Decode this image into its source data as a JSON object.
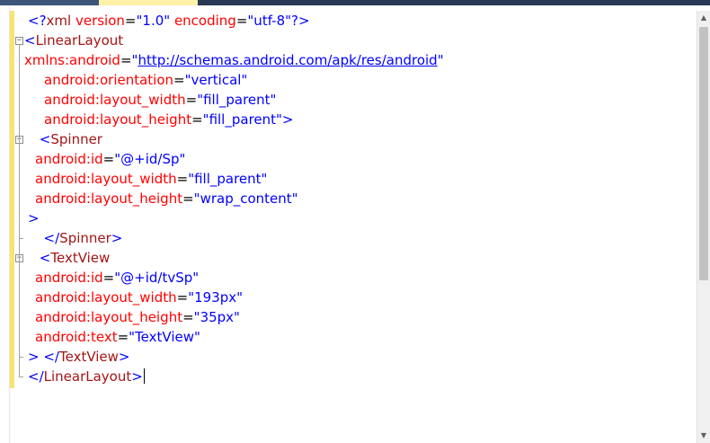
{
  "editor": {
    "lines": [
      {
        "indent": 1,
        "tokens": [
          [
            "br",
            "<?"
          ],
          [
            "tag",
            "xml"
          ],
          [
            "eq",
            " "
          ],
          [
            "attr",
            "version"
          ],
          [
            "eq",
            "="
          ],
          [
            "val",
            "\"1.0\""
          ],
          [
            "eq",
            " "
          ],
          [
            "attr",
            "encoding"
          ],
          [
            "eq",
            "="
          ],
          [
            "val",
            "\"utf-8\""
          ],
          [
            "br",
            "?>"
          ]
        ]
      },
      {
        "indent": 0,
        "tokens": [
          [
            "br",
            "<"
          ],
          [
            "tag",
            "LinearLayout"
          ]
        ]
      },
      {
        "indent": 0,
        "tokens": [
          [
            "attr",
            "xmlns:android"
          ],
          [
            "eq",
            "="
          ],
          [
            "val",
            "\""
          ],
          [
            "link",
            "http://schemas.android.com/apk/res/android"
          ],
          [
            "val",
            "\""
          ]
        ]
      },
      {
        "indent": 2,
        "tokens": [
          [
            "attr",
            "android:orientation"
          ],
          [
            "eq",
            "="
          ],
          [
            "val",
            "\"vertical\""
          ]
        ]
      },
      {
        "indent": 2,
        "tokens": [
          [
            "attr",
            "android:layout_width"
          ],
          [
            "eq",
            "="
          ],
          [
            "val",
            "\"fill_parent\""
          ]
        ]
      },
      {
        "indent": 2,
        "tokens": [
          [
            "attr",
            "android:layout_height"
          ],
          [
            "eq",
            "="
          ],
          [
            "val",
            "\"fill_parent\""
          ],
          [
            "br",
            ">"
          ]
        ]
      },
      {
        "indent": 1,
        "tokens": [
          [
            "eq",
            " "
          ],
          [
            "br",
            "<"
          ],
          [
            "tag",
            "Spinner"
          ]
        ]
      },
      {
        "indent": 1,
        "tokens": [
          [
            "attr",
            "android:id"
          ],
          [
            "eq",
            "="
          ],
          [
            "val",
            "\"@+id/Sp\""
          ]
        ]
      },
      {
        "indent": 1,
        "tokens": [
          [
            "attr",
            "android:layout_width"
          ],
          [
            "eq",
            "="
          ],
          [
            "val",
            "\"fill_parent\""
          ]
        ]
      },
      {
        "indent": 1,
        "tokens": [
          [
            "attr",
            "android:layout_height"
          ],
          [
            "eq",
            "="
          ],
          [
            "val",
            "\"wrap_content\""
          ]
        ]
      },
      {
        "indent": 1,
        "tokens": [
          [
            "br",
            ">"
          ]
        ]
      },
      {
        "indent": 1,
        "tokens": [
          [
            "eq",
            "  "
          ],
          [
            "br",
            "</"
          ],
          [
            "tag",
            "Spinner"
          ],
          [
            "br",
            ">"
          ]
        ]
      },
      {
        "indent": 1,
        "tokens": [
          [
            "eq",
            " "
          ],
          [
            "br",
            "<"
          ],
          [
            "tag",
            "TextView"
          ]
        ]
      },
      {
        "indent": 1,
        "tokens": [
          [
            "attr",
            "android:id"
          ],
          [
            "eq",
            "="
          ],
          [
            "val",
            "\"@+id/tvSp\""
          ]
        ]
      },
      {
        "indent": 1,
        "tokens": [
          [
            "attr",
            "android:layout_width"
          ],
          [
            "eq",
            "="
          ],
          [
            "val",
            "\"193px\""
          ]
        ]
      },
      {
        "indent": 1,
        "tokens": [
          [
            "attr",
            "android:layout_height"
          ],
          [
            "eq",
            "="
          ],
          [
            "val",
            "\"35px\""
          ]
        ]
      },
      {
        "indent": 1,
        "tokens": [
          [
            "attr",
            "android:text"
          ],
          [
            "eq",
            "="
          ],
          [
            "val",
            "\"TextView\""
          ]
        ]
      },
      {
        "indent": 1,
        "tokens": [
          [
            "br",
            ">"
          ],
          [
            "eq",
            " "
          ],
          [
            "br",
            "</"
          ],
          [
            "tag",
            "TextView"
          ],
          [
            "br",
            ">"
          ]
        ]
      },
      {
        "indent": 1,
        "tokens": [
          [
            "br",
            "</"
          ],
          [
            "tag",
            "LinearLayout"
          ],
          [
            "br",
            ">"
          ]
        ],
        "caret": true
      }
    ]
  },
  "fold_markers": [
    {
      "line": 1,
      "symbol": "−"
    },
    {
      "line": 6,
      "symbol": "−"
    },
    {
      "line": 12,
      "symbol": "−"
    }
  ],
  "scrollbar": {
    "up_arrow": "▲",
    "down_arrow": "▼",
    "thumb_fraction": 0.59
  },
  "colors": {
    "change_bar": "#f5e66f",
    "tag": "#a31515",
    "attribute": "#ff0000",
    "value": "#0000ff",
    "bracket": "#0000ff"
  }
}
